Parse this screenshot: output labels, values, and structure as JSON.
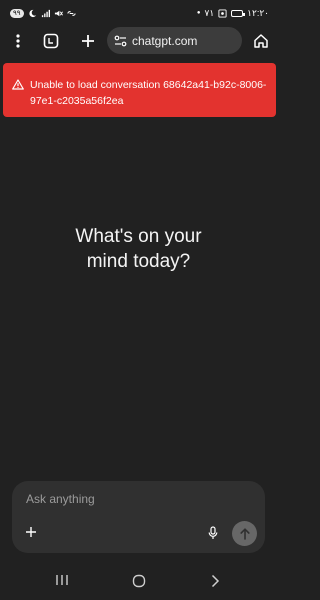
{
  "status_bar": {
    "badge": "٩٩",
    "time": "١٢:٢٠",
    "signal_label": "٧١"
  },
  "toolbar": {
    "url": "chatgpt.com",
    "menu_icon": "more-vert-icon",
    "tabs_icon": "tab-switcher-icon",
    "new_tab_icon": "plus-icon",
    "site_settings_icon": "tune-icon",
    "home_icon": "home-icon"
  },
  "error_banner": {
    "message": "Unable to load conversation 68642a41-b92c-8006-97e1-c2035a56f2ea",
    "color": "#e3332f"
  },
  "main": {
    "headline_line1": "What's on your",
    "headline_line2": "mind today?"
  },
  "composer": {
    "placeholder": "Ask anything"
  },
  "colors": {
    "background": "#212121",
    "composer": "#303030",
    "send_button": "#676767"
  }
}
